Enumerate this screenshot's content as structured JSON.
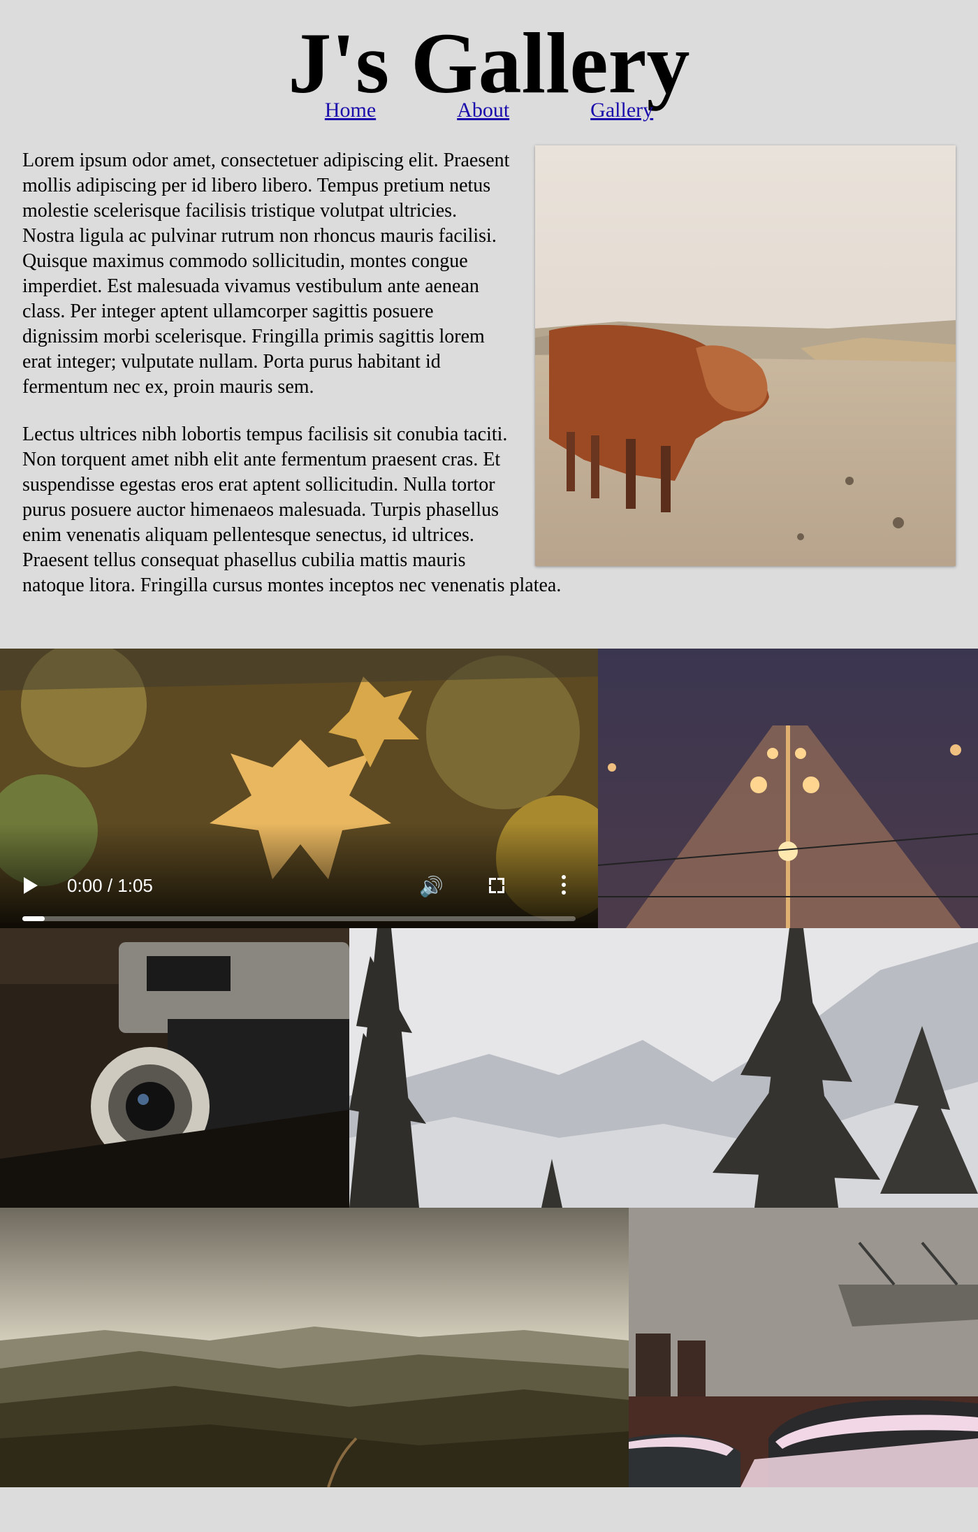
{
  "header": {
    "title": "J's Gallery"
  },
  "nav": {
    "items": [
      {
        "label": "Home"
      },
      {
        "label": "About"
      },
      {
        "label": "Gallery"
      }
    ]
  },
  "intro": {
    "paragraphs": [
      "Lorem ipsum odor amet, consectetuer adipiscing elit. Praesent mollis adipiscing per id libero libero. Tempus pretium netus molestie scelerisque facilisis tristique volutpat ultricies. Nostra ligula ac pulvinar rutrum non rhoncus mauris facilisi. Quisque maximus commodo sollicitudin, montes congue imperdiet. Est malesuada vivamus vestibulum ante aenean class. Per integer aptent ullamcorper sagittis posuere dignissim morbi scelerisque. Fringilla primis sagittis lorem erat integer; vulputate nullam. Porta purus habitant id fermentum nec ex, proin mauris sem.",
      "Lectus ultrices nibh lobortis tempus facilisis sit conubia taciti. Non torquent amet nibh elit ante fermentum praesent cras. Et suspendisse egestas eros erat aptent sollicitudin. Nulla tortor purus posuere auctor himenaeos malesuada. Turpis phasellus enim venenatis aliquam pellentesque senectus, id ultrices. Praesent tellus consequat phasellus cubilia mattis mauris natoque litora. Fringilla cursus montes inceptos nec venenatis platea."
    ]
  },
  "video": {
    "time": "0:00 / 1:05",
    "progress": 0.04,
    "icons": [
      "play-icon",
      "volume-icon",
      "fullscreen-icon",
      "more-options-icon"
    ]
  },
  "colors": {
    "background": "#dcdcdc",
    "link": "#1a0dab"
  }
}
